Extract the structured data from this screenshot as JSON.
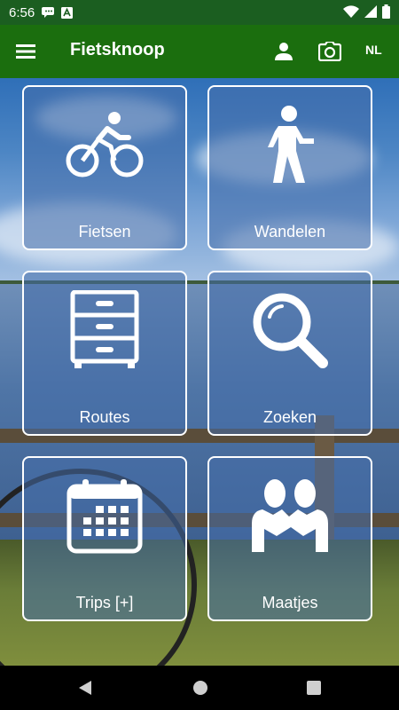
{
  "status": {
    "time": "6:56"
  },
  "app": {
    "title": "Fietsknoop",
    "language": "NL"
  },
  "tiles": [
    {
      "label": "Fietsen",
      "icon": "bicycle-icon"
    },
    {
      "label": "Wandelen",
      "icon": "walking-icon"
    },
    {
      "label": "Routes",
      "icon": "drawers-icon"
    },
    {
      "label": "Zoeken",
      "icon": "search-icon"
    },
    {
      "label": "Trips [+]",
      "icon": "calendar-icon"
    },
    {
      "label": "Maatjes",
      "icon": "friends-icon"
    }
  ],
  "colors": {
    "appbar": "#1b6e0e",
    "statusbar": "#1b5e20",
    "tile_border": "#ffffff"
  }
}
